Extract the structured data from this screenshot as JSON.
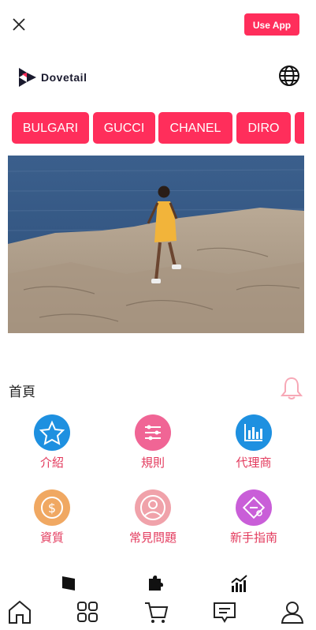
{
  "header": {
    "use_app_label": "Use App",
    "logo_text": "Dovetail"
  },
  "brands": [
    "BULGARI",
    "GUCCI",
    "CHANEL",
    "DIRO"
  ],
  "section": {
    "title": "首頁"
  },
  "grid": [
    {
      "label": "介紹",
      "icon": "star-icon",
      "color": "#1e90e0"
    },
    {
      "label": "規則",
      "icon": "sliders-icon",
      "color": "#f06595"
    },
    {
      "label": "代理商",
      "icon": "bar-chart-icon",
      "color": "#1e90e0"
    },
    {
      "label": "資質",
      "icon": "dollar-icon",
      "color": "#f0a862"
    },
    {
      "label": "常見問題",
      "icon": "user-circle-icon",
      "color": "#f0a2aa"
    },
    {
      "label": "新手指南",
      "icon": "guide-icon",
      "color": "#c95ed8"
    }
  ],
  "colors": {
    "accent": "#ff2e5b",
    "label": "#e33a5d"
  }
}
